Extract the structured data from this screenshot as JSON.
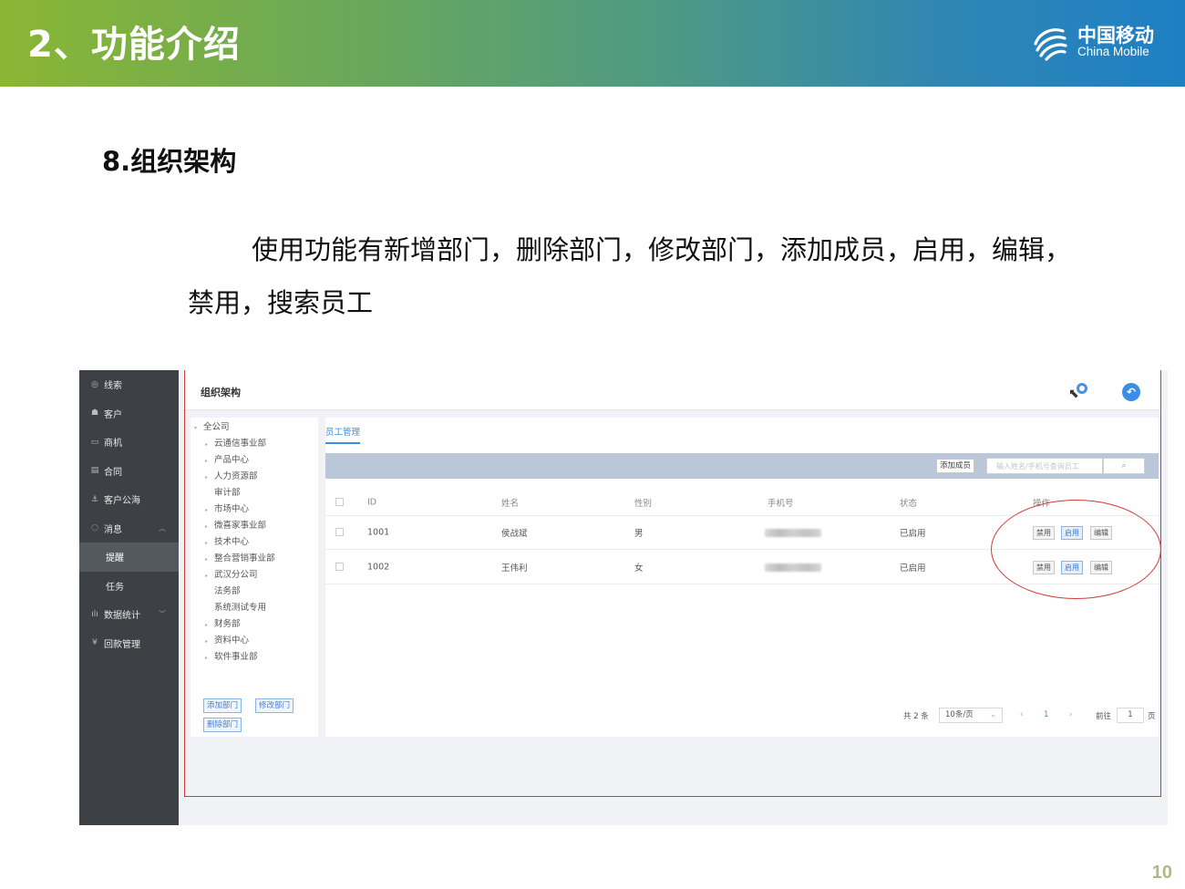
{
  "header": {
    "title": "2、功能介绍",
    "logo_cn": "中国移动",
    "logo_en": "China Mobile"
  },
  "section": {
    "title": "8.组织架构",
    "paragraph": "使用功能有新增部门，删除部门，修改部门，添加成员，启用，编辑，禁用，搜索员工"
  },
  "page_number": "10",
  "sidebar": {
    "items": [
      {
        "label": "线索",
        "icon": "target-icon"
      },
      {
        "label": "客户",
        "icon": "users-icon"
      },
      {
        "label": "商机",
        "icon": "card-icon"
      },
      {
        "label": "合同",
        "icon": "document-icon"
      },
      {
        "label": "客户公海",
        "icon": "anchor-icon"
      },
      {
        "label": "消息",
        "icon": "chat-icon"
      },
      {
        "label": "提醒"
      },
      {
        "label": "任务"
      },
      {
        "label": "数据统计",
        "icon": "bar-chart-icon"
      },
      {
        "label": "回款管理",
        "icon": "yen-icon"
      }
    ]
  },
  "panel": {
    "title": "组织架构"
  },
  "tree": {
    "root": "全公司",
    "items": [
      "云通信事业部",
      "产品中心",
      "人力资源部",
      "审计部",
      "市场中心",
      "微喜家事业部",
      "技术中心",
      "整合营销事业部",
      "武汉分公司",
      "法务部",
      "系统测试专用",
      "财务部",
      "资料中心",
      "软件事业部"
    ],
    "add_dept": "添加部门",
    "edit_dept": "修改部门",
    "delete_dept": "删除部门"
  },
  "main": {
    "tab": "员工管理",
    "add_member": "添加成员",
    "search_placeholder": "输入姓名/手机号查询员工",
    "columns": [
      "ID",
      "姓名",
      "性别",
      "手机号",
      "状态",
      "操作"
    ],
    "rows": [
      {
        "id": "1001",
        "name": "侯战斌",
        "gender": "男",
        "status": "已启用",
        "disable": "禁用",
        "enable": "启用",
        "edit": "编辑"
      },
      {
        "id": "1002",
        "name": "王伟利",
        "gender": "女",
        "status": "已启用",
        "disable": "禁用",
        "enable": "启用",
        "edit": "编辑"
      }
    ],
    "pagination": {
      "total": "共 2 条",
      "page_size": "10条/页",
      "current": "1",
      "goto_label": "前往",
      "goto_value": "1",
      "page_suffix": "页"
    }
  },
  "colors": {
    "sidebar_bg": "#3d4145",
    "accent": "#3b8ee6",
    "annotation": "#d23a3a"
  }
}
